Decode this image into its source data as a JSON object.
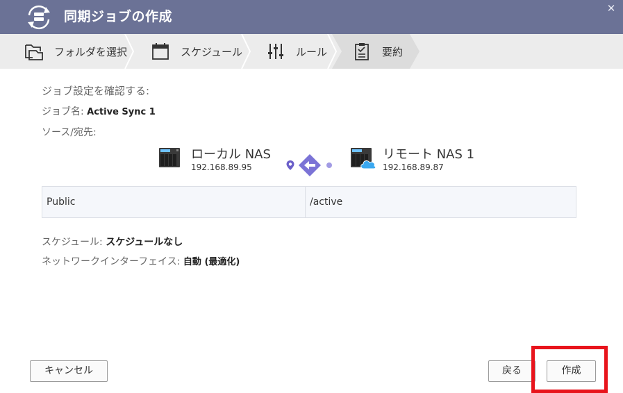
{
  "window": {
    "title": "同期ジョブの作成",
    "close_glyph": "✕"
  },
  "steps": [
    {
      "label": "フォルダを選択",
      "icon": "folder-icon"
    },
    {
      "label": "スケジュール",
      "icon": "calendar-icon"
    },
    {
      "label": "ルール",
      "icon": "sliders-icon"
    },
    {
      "label": "要約",
      "icon": "summary-clipboard-icon"
    }
  ],
  "summary": {
    "heading": "ジョブ設定を確認する:",
    "job_name_label": "ジョブ名:",
    "job_name_value": "Active Sync 1",
    "source_dest_label": "ソース/宛先:",
    "local": {
      "name": "ローカル NAS",
      "ip": "192.168.89.95"
    },
    "remote": {
      "name": "リモート NAS 1",
      "ip": "192.168.89.87"
    },
    "sync_direction_icon": "arrow-left-icon",
    "paths": {
      "local_path": "Public",
      "remote_path": "/active"
    },
    "schedule_label": "スケジュール:",
    "schedule_value": "スケジュールなし",
    "network_label": "ネットワークインターフェイス:",
    "network_value": "自動 (最適化)"
  },
  "buttons": {
    "cancel": "キャンセル",
    "back": "戻る",
    "create": "作成"
  },
  "colors": {
    "titlebar": "#6b7296",
    "accent": "#7b73d6",
    "highlight": "#e8141c",
    "cloud": "#3aa8f0"
  }
}
